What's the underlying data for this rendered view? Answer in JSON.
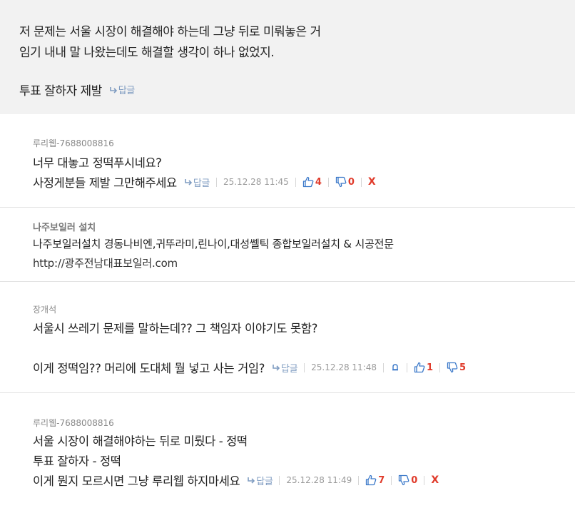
{
  "post": {
    "line1": "저 문제는 서울 시장이 해결해야 하는데 그냥 뒤로 미뤄놓은 거",
    "line2": "임기 내내 말 나왔는데도 해결할 생각이 하나 없었지.",
    "line3": "투표 잘하자 제발",
    "reply_label": "답글"
  },
  "comments": [
    {
      "author": "루리웹-7688008816",
      "lines": [
        "너무 대놓고 정떡푸시네요?",
        "사정게분들 제발 그만해주세요"
      ],
      "reply_label": "답글",
      "date": "25.12.28 11:45",
      "upvotes": "4",
      "downvotes": "0",
      "delete_label": "X"
    },
    {
      "author": "나주보일러 설치",
      "lines": [
        "나주보일러설치 경동나비엔,귀뚜라미,린나이,대성쎌틱 종합보일러설치 & 시공전문",
        "http://광주전남대표보일러.com"
      ]
    },
    {
      "author": "장개석",
      "lines": [
        "서울시 쓰레기 문제를 말하는데?? 그 책임자 이야기도 못함?",
        "이게 정떡임?? 머리에 도대체 뭘 넣고 사는 거임?"
      ],
      "reply_label": "답글",
      "date": "25.12.28 11:48",
      "upvotes": "1",
      "downvotes": "5"
    },
    {
      "author": "루리웹-7688008816",
      "lines": [
        "서울 시장이 해결해야하는 뒤로 미뤘다 - 정떡",
        "투표 잘하자 - 정떡",
        "이게 뭔지 모르시면 그냥 루리웹 하지마세요"
      ],
      "reply_label": "답글",
      "date": "25.12.28 11:49",
      "upvotes": "7",
      "downvotes": "0",
      "delete_label": "X"
    }
  ],
  "colors": {
    "accent_link": "#7f9cc1",
    "vote_count": "#e03b2b",
    "thumb_icon": "#3a78c9",
    "post_background": "#f2f2f2"
  },
  "icons": [
    "reply-arrow-icon",
    "thumbs-up-icon",
    "thumbs-down-icon",
    "bell-report-icon"
  ]
}
